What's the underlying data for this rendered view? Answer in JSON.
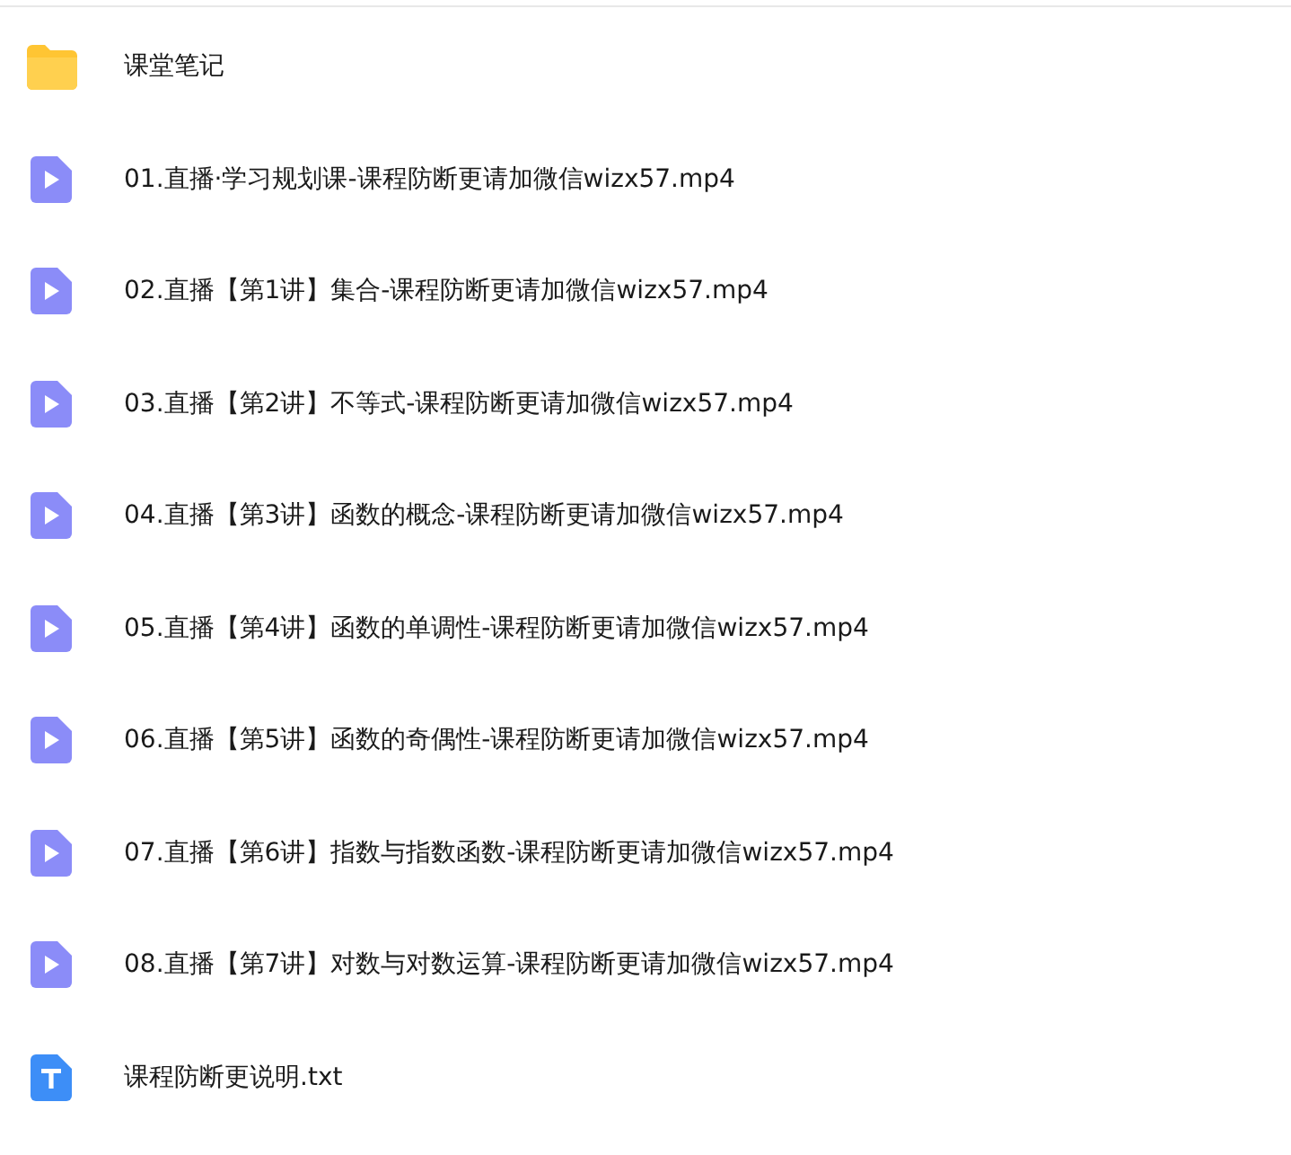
{
  "files": [
    {
      "kind": "folder",
      "name": "课堂笔记"
    },
    {
      "kind": "video",
      "name": "01.直播·学习规划课-课程防断更请加微信wizx57.mp4"
    },
    {
      "kind": "video",
      "name": "02.直播【第1讲】集合-课程防断更请加微信wizx57.mp4"
    },
    {
      "kind": "video",
      "name": "03.直播【第2讲】不等式-课程防断更请加微信wizx57.mp4"
    },
    {
      "kind": "video",
      "name": "04.直播【第3讲】函数的概念-课程防断更请加微信wizx57.mp4"
    },
    {
      "kind": "video",
      "name": "05.直播【第4讲】函数的单调性-课程防断更请加微信wizx57.mp4"
    },
    {
      "kind": "video",
      "name": "06.直播【第5讲】函数的奇偶性-课程防断更请加微信wizx57.mp4"
    },
    {
      "kind": "video",
      "name": "07.直播【第6讲】指数与指数函数-课程防断更请加微信wizx57.mp4"
    },
    {
      "kind": "video",
      "name": "08.直播【第7讲】对数与对数运算-课程防断更请加微信wizx57.mp4"
    },
    {
      "kind": "text",
      "name": "课程防断更说明.txt"
    }
  ]
}
